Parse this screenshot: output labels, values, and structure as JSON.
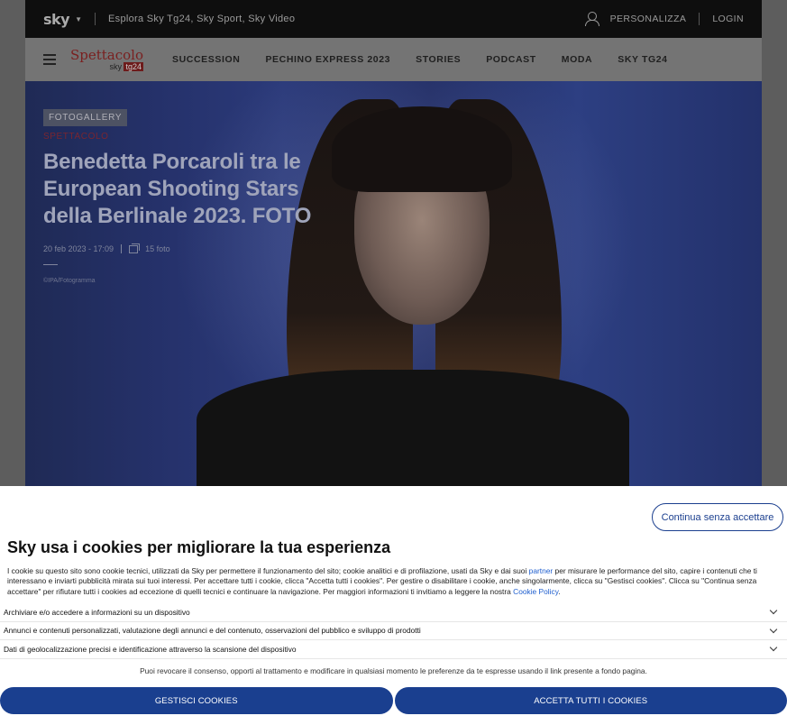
{
  "topbar": {
    "logo": "sky",
    "explore": "Esplora Sky Tg24, Sky Sport, Sky Video",
    "personalizza": "PERSONALIZZA",
    "login": "LOGIN"
  },
  "navbar": {
    "brand_title": "Spettacolo",
    "brand_sub_prefix": "sky",
    "brand_sub_badge": "tg24",
    "items": [
      "SUCCESSION",
      "PECHINO EXPRESS 2023",
      "STORIES",
      "PODCAST",
      "MODA",
      "SKY TG24"
    ]
  },
  "article": {
    "tag": "FOTOGALLERY",
    "category": "SPETTACOLO",
    "headline": "Benedetta Porcaroli tra le European Shooting Stars della Berlinale 2023. FOTO",
    "date": "20 feb 2023 - 17:09",
    "photo_count": "15 foto",
    "credit": "©IPA/Fotogramma"
  },
  "consent": {
    "continue_label": "Continua senza accettare",
    "title": "Sky usa i cookies per migliorare la tua esperienza",
    "text_part1": "I cookie su questo sito sono cookie tecnici, utilizzati da Sky per permettere il funzionamento del sito; cookie analitici e di profilazione, usati da Sky e dai suoi ",
    "partner_link": "partner",
    "text_part2": " per misurare le performance del sito, capire i contenuti che ti interessano e inviarti pubblicità mirata sui tuoi interessi. Per accettare tutti i cookie, clicca \"Accetta tutti i cookies\". Per gestire o disabilitare i cookie, anche singolarmente, clicca su \"Gestisci cookies\". Clicca su \"Continua senza accettare\" per rifiutare tutti i cookies ad eccezione di quelli tecnici e continuare la navigazione. Per maggiori informazioni ti invitiamo a leggere la nostra ",
    "policy_link": "Cookie Policy",
    "text_part3": ".",
    "purposes": [
      "Archiviare e/o accedere a informazioni su un dispositivo",
      "Annunci e contenuti personalizzati, valutazione degli annunci e del contenuto, osservazioni del pubblico e sviluppo di prodotti",
      "Dati di geolocalizzazione precisi e identificazione attraverso la scansione del dispositivo"
    ],
    "revoke": "Puoi revocare il consenso, opporti al trattamento e modificare in qualsiasi momento le preferenze da te espresse usando il link presente a fondo pagina.",
    "manage_label": "GESTISCI COOKIES",
    "accept_label": "ACCETTA TUTTI I COOKIES"
  }
}
